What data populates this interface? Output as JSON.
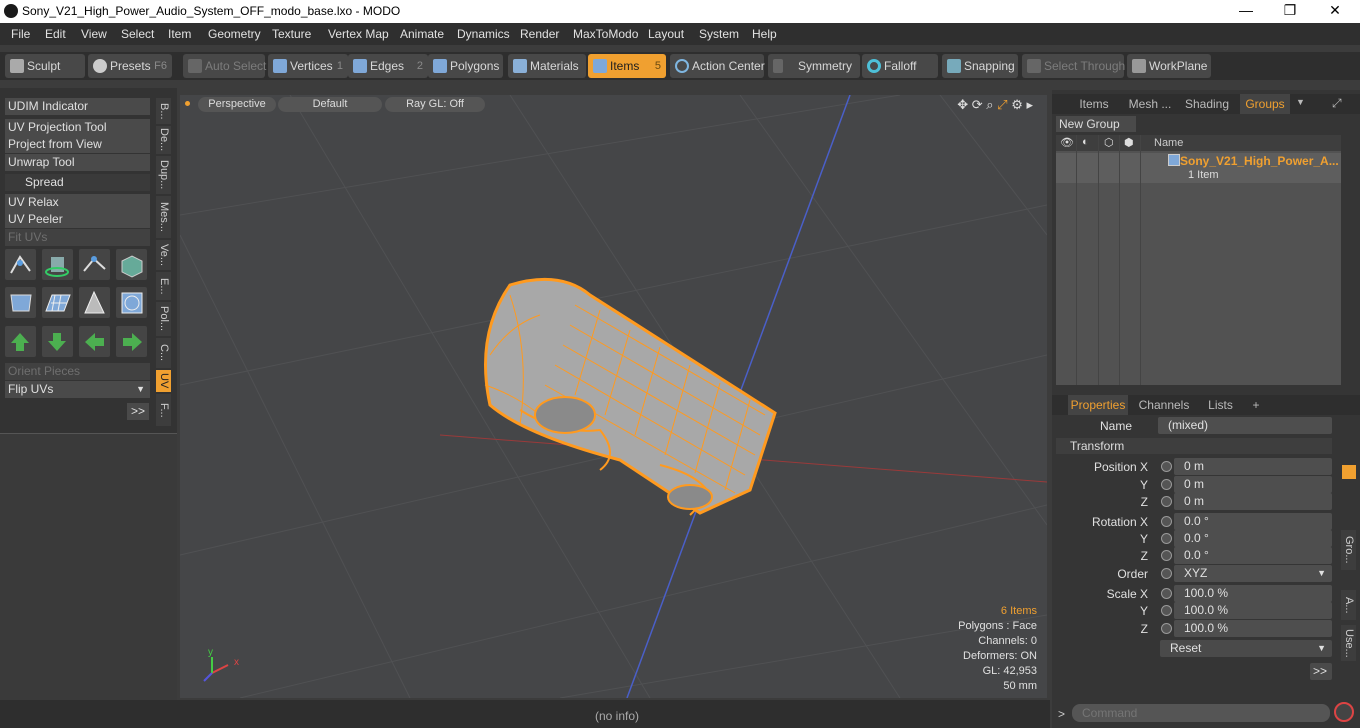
{
  "window": {
    "title": "Sony_V21_High_Power_Audio_System_OFF_modo_base.lxo - MODO",
    "minimize": "—",
    "maximize": "❐",
    "close": "✕"
  },
  "menu": [
    "File",
    "Edit",
    "View",
    "Select",
    "Item",
    "Geometry",
    "Texture",
    "Vertex Map",
    "Animate",
    "Dynamics",
    "Render",
    "MaxToModo",
    "Layout",
    "System",
    "Help"
  ],
  "toolbar": {
    "sculpt": "Sculpt",
    "presets": "Presets",
    "presets_key": "F6",
    "auto_select": "Auto Select",
    "vertices": "Vertices",
    "vertices_num": "1",
    "edges": "Edges",
    "edges_num": "2",
    "polygons": "Polygons",
    "materials": "Materials",
    "items": "Items",
    "items_num": "5",
    "action_center": "Action Center",
    "symmetry": "Symmetry",
    "falloff": "Falloff",
    "snapping": "Snapping",
    "select_through": "Select Through",
    "workplane": "WorkPlane"
  },
  "left": {
    "udim": "UDIM Indicator",
    "uv_projection": "UV Projection Tool",
    "project_view": "Project from View",
    "unwrap": "Unwrap Tool",
    "spread": "Spread",
    "uv_relax": "UV Relax",
    "uv_peeler": "UV Peeler",
    "fit_uvs": "Fit UVs",
    "orient": "Orient Pieces",
    "flip_uvs": "Flip UVs",
    "more": ">>",
    "side_tabs": [
      "B...",
      "De...",
      "Dup...",
      "Mes...",
      "Ve...",
      "E...",
      "Pol...",
      "C...",
      "UV",
      "F..."
    ]
  },
  "viewport": {
    "perspective": "Perspective",
    "default": "Default",
    "raygl": "Ray GL: Off",
    "items_count": "6 Items",
    "polygons": "Polygons : Face",
    "channels": "Channels: 0",
    "deformers": "Deformers: ON",
    "gl": "GL: 42,953",
    "distance": "50 mm"
  },
  "status": {
    "info": "(no info)"
  },
  "groups_panel": {
    "tabs": [
      "Items",
      "Mesh ...",
      "Shading",
      "Groups"
    ],
    "new_group": "New Group",
    "name_col": "Name",
    "item_name": "Sony_V21_High_Power_A...",
    "item_sub": "1 Item"
  },
  "properties": {
    "tabs": [
      "Properties",
      "Channels",
      "Lists"
    ],
    "add_tab": "+",
    "name_label": "Name",
    "name_value": "(mixed)",
    "transform": "Transform",
    "position_x_label": "Position X",
    "pos_x": "0 m",
    "y_label": "Y",
    "pos_y": "0 m",
    "z_label": "Z",
    "pos_z": "0 m",
    "rotation_x_label": "Rotation X",
    "rot_x": "0.0 °",
    "rot_y": "0.0 °",
    "rot_z": "0.0 °",
    "order_label": "Order",
    "order_value": "XYZ",
    "scale_x_label": "Scale X",
    "scale_x": "100.0 %",
    "scale_y": "100.0 %",
    "scale_z": "100.0 %",
    "reset": "Reset",
    "more": ">>",
    "side_tabs": [
      "Gro...",
      "A...",
      "Use..."
    ]
  },
  "command": {
    "placeholder": "Command",
    "prompt": ">"
  },
  "colors": {
    "accent": "#f0a030",
    "viewport_bg": "#454648",
    "panel_bg": "#353535"
  }
}
